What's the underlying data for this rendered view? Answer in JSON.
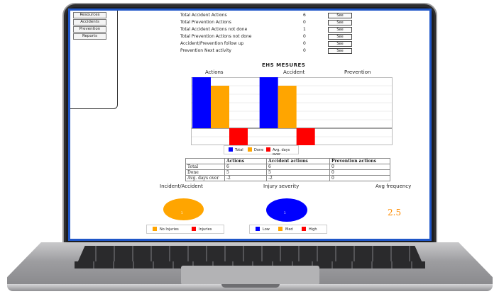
{
  "sidebar": {
    "items": [
      {
        "label": "Resources"
      },
      {
        "label": "Accidents"
      },
      {
        "label": "Prevention"
      },
      {
        "label": "Reports"
      }
    ]
  },
  "summary": {
    "see_label": "See",
    "rows": [
      {
        "label": "Total Accident Actions",
        "count": "6"
      },
      {
        "label": "Total Prevention Actions",
        "count": "0"
      },
      {
        "label": "Total Accident Actions not done",
        "count": "1"
      },
      {
        "label": "Total Prevention Actions not done",
        "count": "0"
      },
      {
        "label": "Accident/Prevention follow up",
        "count": "0"
      },
      {
        "label": "Prevention Next activity",
        "count": "0"
      }
    ]
  },
  "measures": {
    "title": "EHS MESURES",
    "group_titles": [
      "Actions",
      "Accident",
      "Prevention"
    ]
  },
  "chart_data": {
    "type": "bar",
    "categories": [
      "Actions",
      "Accident",
      "Prevention"
    ],
    "series": [
      {
        "name": "Total",
        "values": [
          6,
          6,
          0
        ],
        "color": "#0000ff"
      },
      {
        "name": "Done",
        "values": [
          5,
          5,
          0
        ],
        "color": "#ffa500"
      },
      {
        "name": "Avg. days over",
        "values": [
          -2,
          -2,
          0
        ],
        "color": "#ff0000"
      }
    ],
    "ylim": [
      -2,
      6
    ]
  },
  "table": {
    "headers": [
      "",
      "Actions",
      "Accident actions",
      "Prevention actions"
    ],
    "rows": [
      [
        "Total",
        "6",
        "6",
        "0"
      ],
      [
        "Done",
        "5",
        "5",
        "0"
      ],
      [
        "Avg. days over",
        "-2",
        "-2",
        "0"
      ]
    ]
  },
  "bottom": {
    "pie1_title": "Incident/Accident",
    "pie2_title": "Injury severity",
    "freq_title": "Avg frequency",
    "freq_value": "2.5",
    "pie1_label": "1",
    "pie2_label": "1",
    "legend1": [
      {
        "name": "No Injuries",
        "color": "#ffa500"
      },
      {
        "name": "Injuries",
        "color": "#ff0000"
      }
    ],
    "legend2": [
      {
        "name": "Low",
        "color": "#0000ff"
      },
      {
        "name": "Med",
        "color": "#ffa500"
      },
      {
        "name": "High",
        "color": "#ff0000"
      }
    ]
  }
}
